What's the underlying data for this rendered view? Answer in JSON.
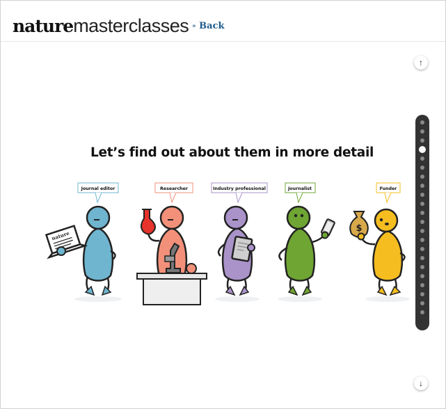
{
  "header": {
    "logo_bold": "nature",
    "logo_light": "masterclasses",
    "back_prefix": "»",
    "back_label": "Back"
  },
  "headline": "Let’s find out about them in more detail",
  "characters": [
    {
      "role": "Journal editor",
      "color": "#6fb5cf",
      "bubble_color": "#6fb5cf",
      "prop_text": "nature"
    },
    {
      "role": "Researcher",
      "color": "#f2907a",
      "bubble_color": "#f2907a"
    },
    {
      "role": "Industry professional",
      "color": "#a993c9",
      "bubble_color": "#a993c9"
    },
    {
      "role": "Journalist",
      "color": "#6fa533",
      "bubble_color": "#6fa533"
    },
    {
      "role": "Funder",
      "color": "#f5bd1f",
      "bubble_color": "#f5bd1f",
      "prop_text": "$"
    }
  ],
  "controls": {
    "scroll_up_icon": "↑",
    "scroll_down_icon": "↓"
  },
  "nav": {
    "dot_count": 22,
    "active_index": 3
  }
}
